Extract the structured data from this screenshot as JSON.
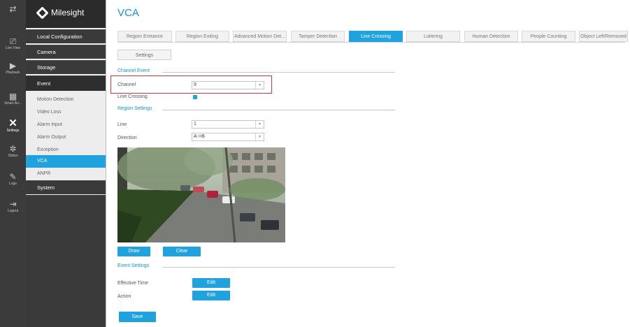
{
  "rail": [
    {
      "icon": "live-view-icon",
      "glyph": "⎚",
      "label": "Live View"
    },
    {
      "icon": "playback-icon",
      "glyph": "▶",
      "label": "Playback"
    },
    {
      "icon": "smart-analysis-icon",
      "glyph": "▦",
      "label": "Smart Ari..."
    },
    {
      "icon": "settings-icon",
      "glyph": "✕",
      "label": "Settings"
    },
    {
      "icon": "status-icon",
      "glyph": "✲",
      "label": "Status"
    },
    {
      "icon": "logs-icon",
      "glyph": "✎",
      "label": "Logs"
    },
    {
      "icon": "logout-icon",
      "glyph": "⇥",
      "label": "Logout"
    }
  ],
  "brand": {
    "name": "Milesight"
  },
  "menu": {
    "local_configuration": "Local Configuration",
    "camera": "Camera",
    "storage": "Storage",
    "event": "Event",
    "motion_detection": "Motion Detection",
    "video_loss": "Video Loss",
    "alarm_input": "Alarm Input",
    "alarm_output": "Alarm Output",
    "exception": "Exception",
    "vca": "VCA",
    "anpr": "ANPR",
    "system": "System"
  },
  "page": {
    "title": "VCA"
  },
  "tabs": [
    "Region Entrance",
    "Region Exiting",
    "Advanced Motion Det...",
    "Tamper Detection",
    "Line Crossing",
    "Loitering",
    "Human Detection",
    "People Counting",
    "Object Left/Removed"
  ],
  "subtab": {
    "label": "Settings"
  },
  "channel_event": {
    "title": "Channel Event",
    "channel_label": "Channel",
    "channel_value": "9",
    "line_crossing_label": "Line Crossing",
    "line_crossing_enabled": true
  },
  "region_settings": {
    "title": "Region Settings",
    "line_label": "Line",
    "line_value": "1",
    "direction_label": "Direction",
    "direction_value": "A->B"
  },
  "buttons": {
    "draw": "Draw",
    "clear": "Clear",
    "edit": "Edit",
    "save": "Save"
  },
  "event_settings": {
    "title": "Event Settings",
    "effective_time_label": "Effective Time",
    "action_label": "Action"
  },
  "colors": {
    "accent": "#1fa2dd",
    "highlight": "#d33b3b",
    "sidebar_dark": "#3a3a3a"
  }
}
